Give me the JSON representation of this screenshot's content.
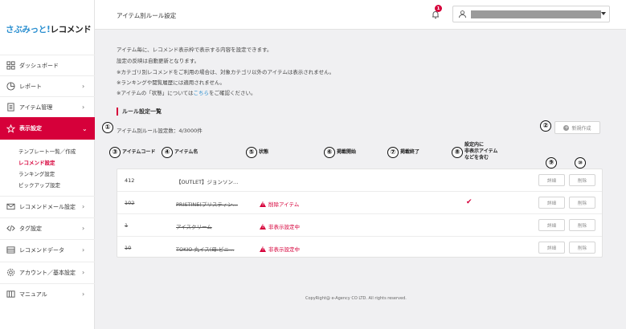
{
  "app": {
    "logo_main": "さぶみっと!",
    "logo_sub": "レコメンド"
  },
  "sidebar": {
    "items": [
      {
        "label": "ダッシュボード",
        "icon": "dashboard-icon",
        "chevron": ""
      },
      {
        "label": "レポート",
        "icon": "chart-icon",
        "chevron": "›"
      },
      {
        "label": "アイテム管理",
        "icon": "document-icon",
        "chevron": "›"
      },
      {
        "label": "表示設定",
        "icon": "star-icon",
        "chevron": "⌄",
        "active": true
      },
      {
        "label": "レコメンドメール設定",
        "icon": "mail-icon",
        "chevron": "›"
      },
      {
        "label": "タグ設定",
        "icon": "code-icon",
        "chevron": "›"
      },
      {
        "label": "レコメンドデータ",
        "icon": "database-icon",
        "chevron": "›"
      },
      {
        "label": "アカウント／基本設定",
        "icon": "gear-icon",
        "chevron": "›"
      },
      {
        "label": "マニュアル",
        "icon": "book-icon",
        "chevron": "›"
      }
    ],
    "subitems": [
      {
        "label": "テンプレート一覧／作成"
      },
      {
        "label": "レコメンド設定",
        "current": true
      },
      {
        "label": "ランキング設定"
      },
      {
        "label": "ピックアップ設定"
      }
    ]
  },
  "header": {
    "title": "アイテム別ルール設定",
    "notification_count": "1"
  },
  "intro": {
    "line1": "アイテム毎に、レコメンド表示枠で表示する内容を設定できます。",
    "line2": "設定の反映は自動更新となります。",
    "line3": "※カテゴリ別レコメンドをご利用の場合は、対象カテゴリ以外のアイテムは表示されません。",
    "line4": "※ランキングや閲覧履歴には適用されません。",
    "line5_pre": "※アイテムの「状態」については",
    "line5_link": "こちら",
    "line5_post": "をご確認ください。"
  },
  "section": {
    "title": "ルール設定一覧",
    "count": "アイテム別ルール設定数：4/3000件",
    "new_button": "新規作成"
  },
  "markers": [
    "①",
    "②",
    "③",
    "④",
    "⑤",
    "⑥",
    "⑦",
    "⑧",
    "⑨",
    "⑩"
  ],
  "table": {
    "headers": {
      "code": "アイテムコード",
      "name": "アイテム名",
      "status": "状態",
      "start": "掲載開始",
      "end": "掲載終了",
      "include_line1": "設定内に",
      "include_line2": "非表示アイテム",
      "include_line3": "などを含む"
    },
    "detail_label": "詳細",
    "delete_label": "削除",
    "rows": [
      {
        "code": "412",
        "name": "【OUTLET】ジョンソン…",
        "status": "",
        "check": "",
        "struck": false
      },
      {
        "code": "102",
        "name": "PRISTINE(プリスティン…",
        "status": "削除アイテム",
        "check": "✔",
        "struck": true
      },
      {
        "code": "1",
        "name": "アイスクリーム",
        "status": "非表示設定中",
        "check": "",
        "struck": true
      },
      {
        "code": "10",
        "name": "TOKIO 丸イス(母:ピニ…",
        "status": "非表示設定中",
        "check": "",
        "struck": true
      }
    ]
  },
  "footer": {
    "text": "CopyRight@ e-Agency CO LTD. All rights reserved."
  },
  "colors": {
    "accent": "#d6003a",
    "link": "#2a8fd0"
  }
}
